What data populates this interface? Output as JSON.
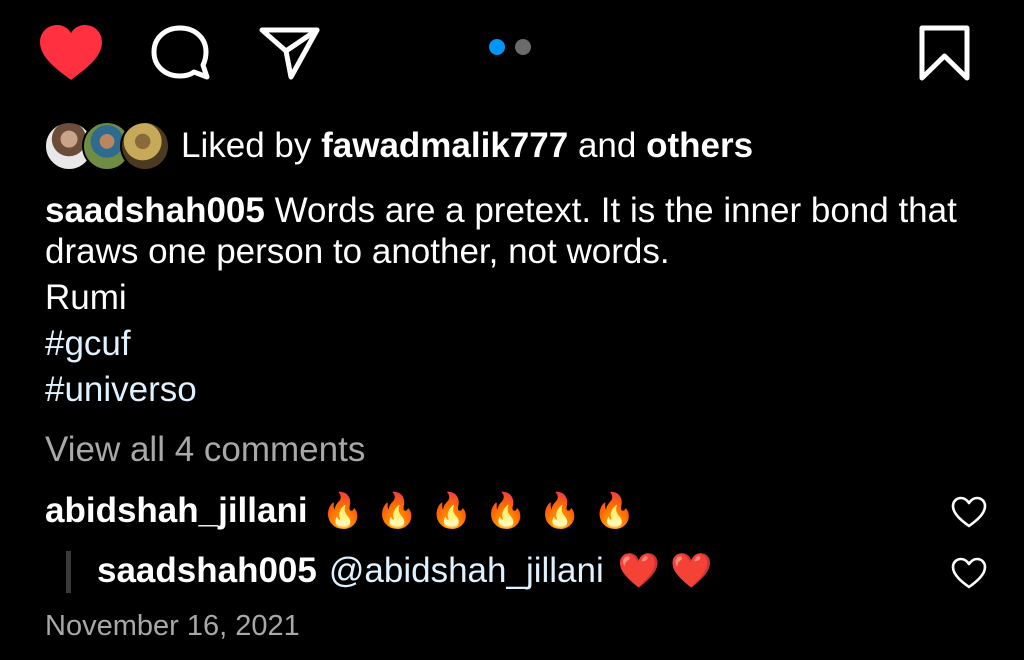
{
  "actions": {
    "like_icon": "heart-filled-icon",
    "comment_icon": "speech-bubble-icon",
    "share_icon": "paper-plane-icon",
    "save_icon": "bookmark-icon",
    "like_color": "#ff3040"
  },
  "carousel": {
    "active_color": "#0095f6",
    "inactive_color": "#6b6b6b",
    "count": 2,
    "active_index": 0
  },
  "likes": {
    "prefix": "Liked by",
    "user": "fawadmalik777",
    "connector": "and",
    "others": "others"
  },
  "caption": {
    "username": "saadshah005",
    "text": "Words are a pretext. It is the inner bond that draws one person to another, not words.",
    "line_author": "Rumi",
    "hashtag_1": "#gcuf",
    "hashtag_2": "#universo"
  },
  "comments": {
    "view_all_label": "View all 4 comments",
    "first": {
      "username": "abidshah_jillani",
      "emoji": "🔥🔥🔥🔥🔥🔥",
      "like_icon": "heart-outline-icon"
    },
    "reply": {
      "username": "saadshah005",
      "mention": "@abidshah_jillani",
      "emoji": "❤️❤️",
      "like_icon": "heart-outline-icon"
    }
  },
  "post": {
    "date": "November 16, 2021"
  }
}
